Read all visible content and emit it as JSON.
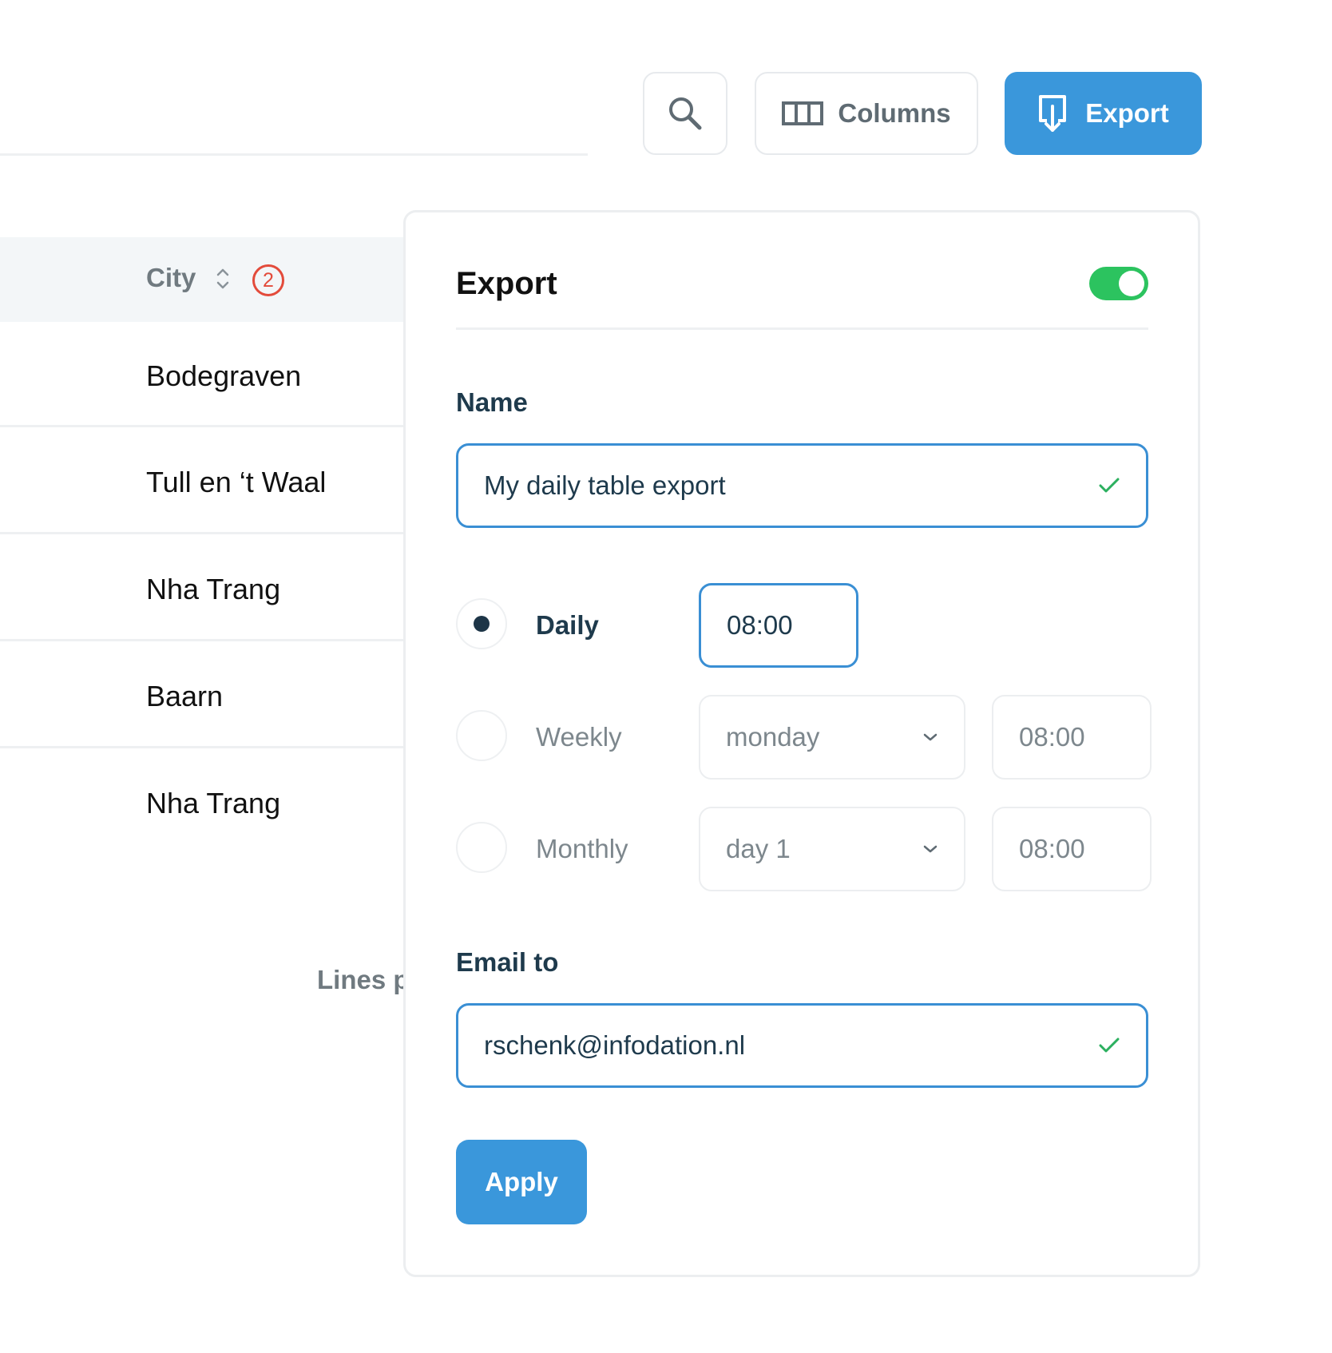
{
  "toolbar": {
    "columns_label": "Columns",
    "export_label": "Export"
  },
  "table": {
    "header": {
      "city_label": "City",
      "filter_count": "2"
    },
    "rows": [
      "Bodegraven",
      "Tull en ‘t Waal",
      "Nha Trang",
      "Baarn",
      "Nha Trang"
    ],
    "lines_per_page_label": "Lines p"
  },
  "export_panel": {
    "title": "Export",
    "enabled": true,
    "name_label": "Name",
    "name_value": "My daily table export",
    "frequency": [
      {
        "label": "Daily",
        "selected": true,
        "time": "08:00"
      },
      {
        "label": "Weekly",
        "selected": false,
        "day": "monday",
        "time": "08:00"
      },
      {
        "label": "Monthly",
        "selected": false,
        "day": "day 1",
        "time": "08:00"
      }
    ],
    "email_label": "Email to",
    "email_value": "rschenk@infodation.nl",
    "apply_label": "Apply"
  },
  "colors": {
    "accent": "#3a97db",
    "toggle_on": "#2cc35f",
    "valid_check": "#2cb05f",
    "badge": "#e34b3b"
  }
}
